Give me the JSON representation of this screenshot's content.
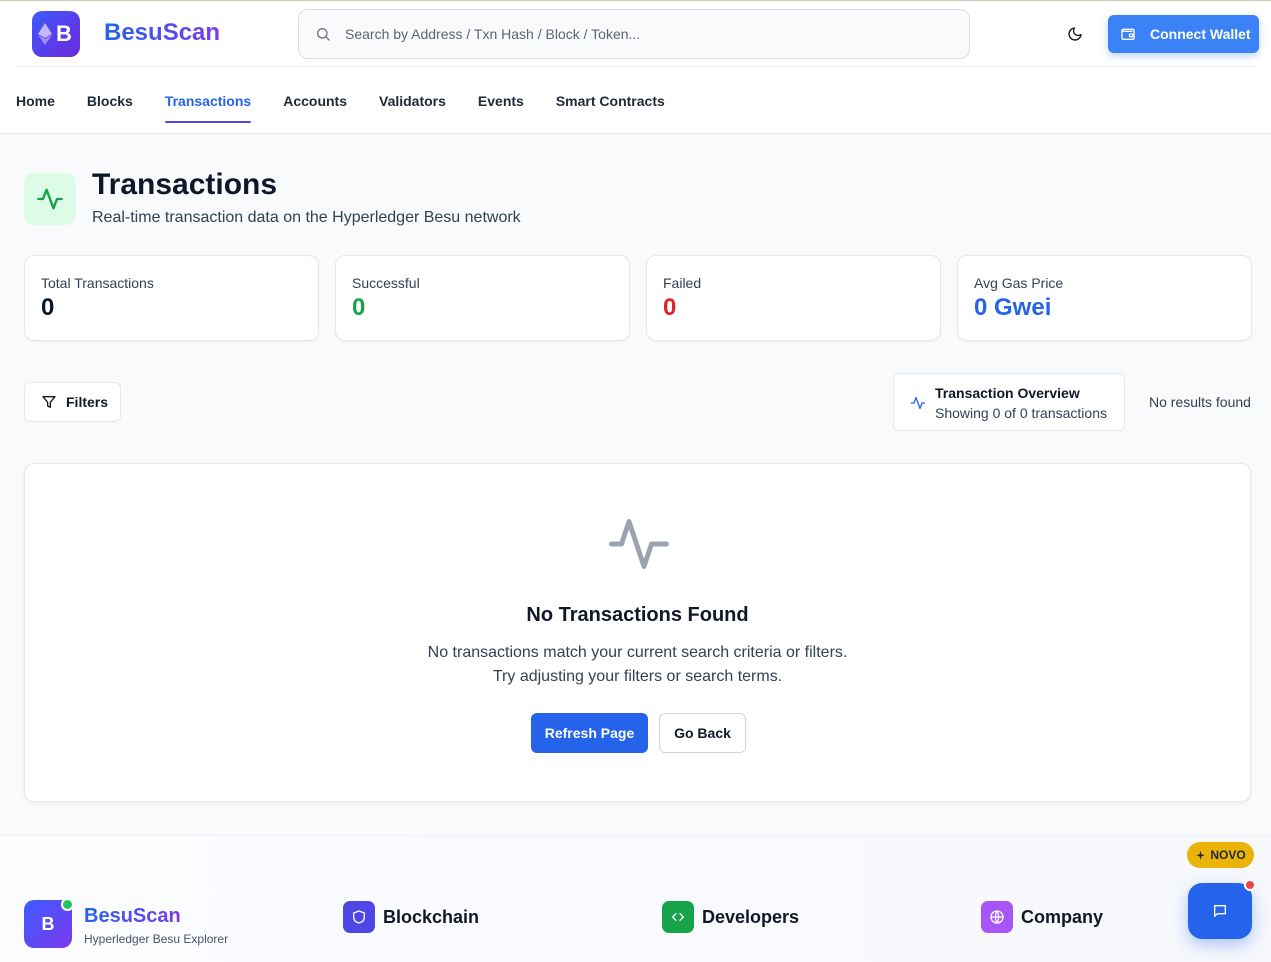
{
  "header": {
    "brand": "BesuScan",
    "logo_letter": "B",
    "search_placeholder": "Search by Address / Txn Hash / Block / Token...",
    "connect_label": "Connect Wallet"
  },
  "nav": {
    "items": [
      "Home",
      "Blocks",
      "Transactions",
      "Accounts",
      "Validators",
      "Events",
      "Smart Contracts"
    ],
    "active": "Transactions"
  },
  "page": {
    "title": "Transactions",
    "subtitle": "Real-time transaction data on the Hyperledger Besu network"
  },
  "stats": [
    {
      "label": "Total Transactions",
      "value": "0",
      "color": "#0f172a"
    },
    {
      "label": "Successful",
      "value": "0",
      "color": "#16a34a"
    },
    {
      "label": "Failed",
      "value": "0",
      "color": "#dc2626"
    },
    {
      "label": "Avg Gas Price",
      "value": "0 Gwei",
      "color": "#2563eb"
    }
  ],
  "toolbar": {
    "filters_label": "Filters",
    "overview_title": "Transaction Overview",
    "overview_sub": "Showing 0 of 0 transactions",
    "no_results": "No results found"
  },
  "empty": {
    "title": "No Transactions Found",
    "desc1": "No transactions match your current search criteria or filters.",
    "desc2": "Try adjusting your filters or search terms.",
    "refresh_label": "Refresh Page",
    "back_label": "Go Back"
  },
  "footer": {
    "logo_letter": "B",
    "brand": "BesuScan",
    "tagline": "Hyperledger Besu Explorer",
    "columns": [
      {
        "label": "Blockchain",
        "icon": "shield-icon",
        "color": "#4f46e5"
      },
      {
        "label": "Developers",
        "icon": "code-icon",
        "color": "#16a34a"
      },
      {
        "label": "Company",
        "icon": "globe-icon",
        "color": "#9333ea"
      }
    ],
    "novo_label": "NOVO"
  },
  "colors": {
    "accent": "#2563eb",
    "success": "#16a34a",
    "danger": "#dc2626",
    "badge": "#eab308"
  }
}
